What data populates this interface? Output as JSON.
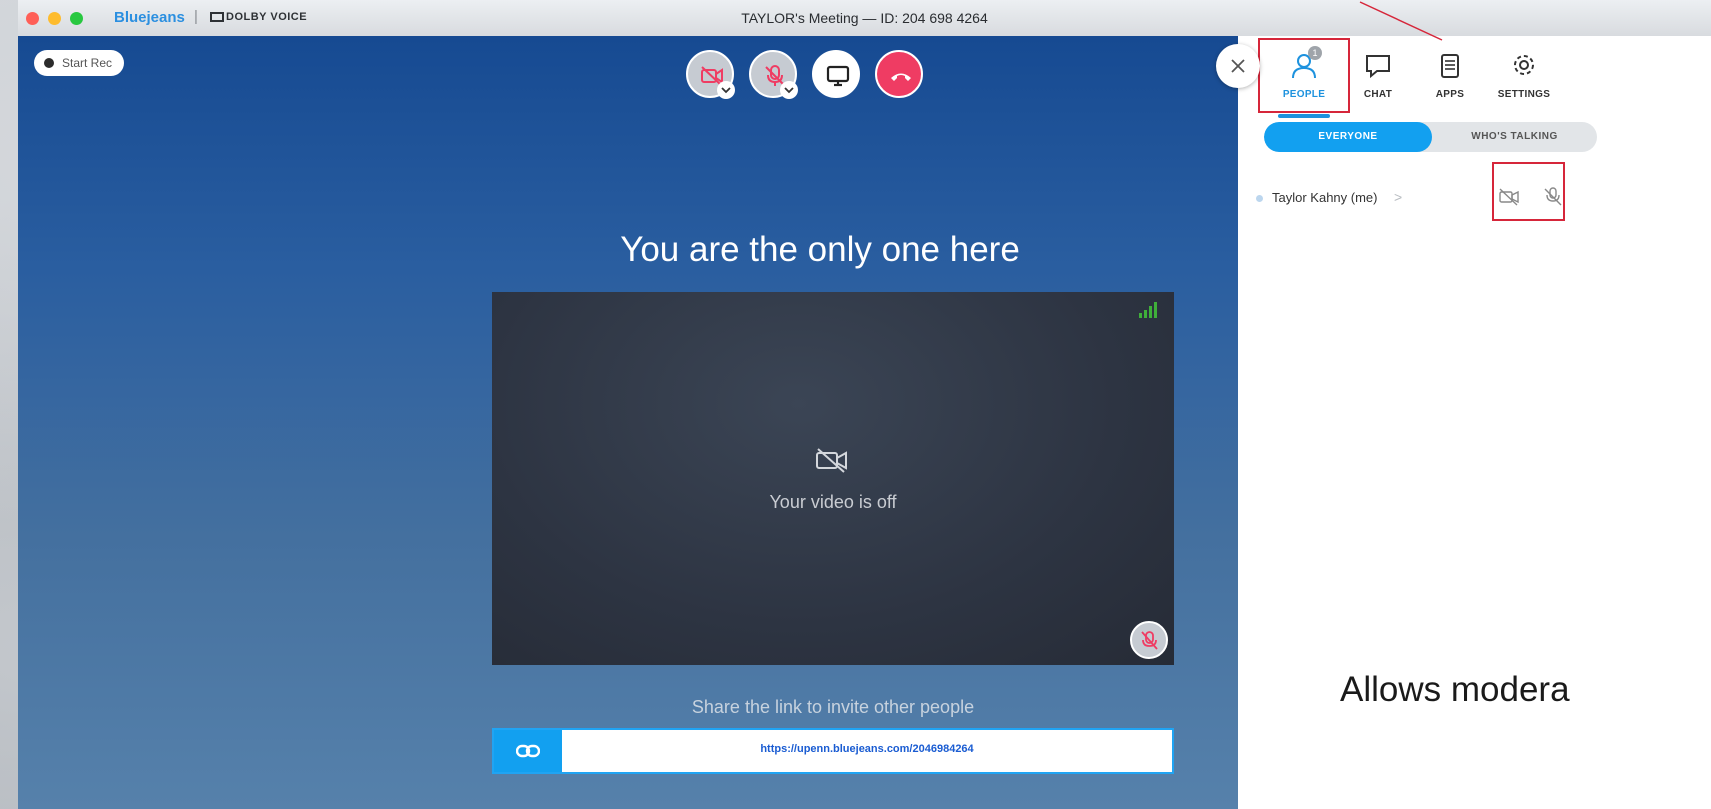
{
  "window": {
    "brand": "Bluejeans",
    "separator": "|",
    "dolby": "DOLBY VOICE",
    "title": "TAYLOR's Meeting — ID: 204 698 4264"
  },
  "stage": {
    "record_label": "Start Rec",
    "heading": "You are the only one here",
    "video_off_text": "Your video is off",
    "share_prompt": "Share the link to invite other people",
    "share_url": "https://upenn.bluejeans.com/2046984264"
  },
  "panel": {
    "tabs": [
      {
        "label": "PEOPLE",
        "badge": "1"
      },
      {
        "label": "CHAT"
      },
      {
        "label": "APPS"
      },
      {
        "label": "SETTINGS"
      }
    ],
    "segments": [
      "EVERYONE",
      "WHO'S TALKING"
    ],
    "participants": [
      {
        "name": "Taylor Kahny (me)",
        "chevron": ">"
      }
    ]
  },
  "annotation": {
    "caption": "Allows modera",
    "color": "#d6263a"
  },
  "colors": {
    "accent": "#12a0f0",
    "hangup": "#ef3c63",
    "stage_top": "#164a92"
  }
}
